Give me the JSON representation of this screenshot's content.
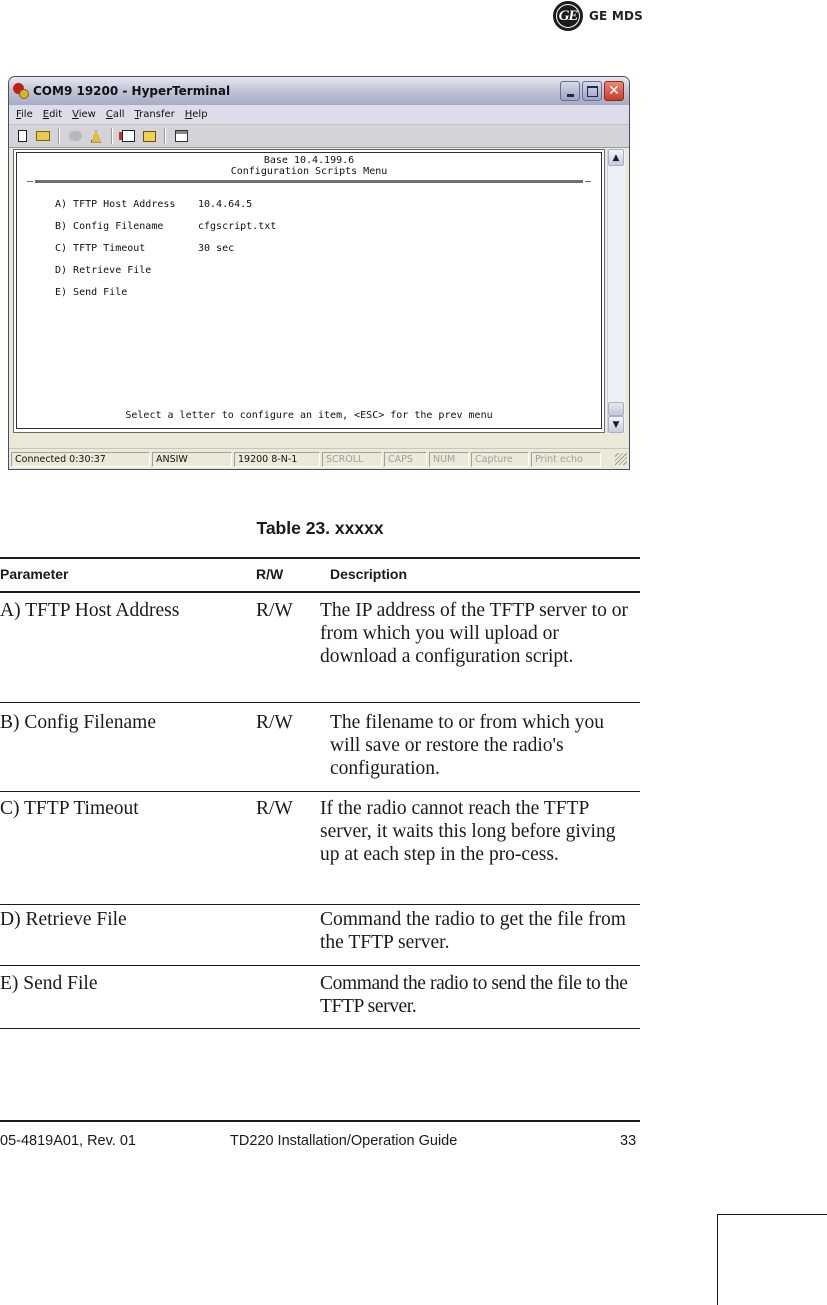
{
  "brand": {
    "logo_mark": "GE",
    "logo_text": "GE MDS"
  },
  "window": {
    "title": "COM9 19200 - HyperTerminal",
    "menu": [
      {
        "accel": "F",
        "rest": "ile"
      },
      {
        "accel": "E",
        "rest": "dit"
      },
      {
        "accel": "V",
        "rest": "iew"
      },
      {
        "accel": "C",
        "rest": "all"
      },
      {
        "accel": "T",
        "rest": "ransfer"
      },
      {
        "accel": "H",
        "rest": "elp"
      }
    ],
    "toolbar_icons": [
      "new-connection-icon",
      "open-icon",
      "connect-icon",
      "disconnect-icon",
      "send-icon",
      "receive-icon",
      "properties-icon"
    ],
    "terminal": {
      "header_line1": "Base 10.4.199.6",
      "header_line2": "Configuration Scripts Menu",
      "items": [
        {
          "label": "A) TFTP Host Address",
          "value": "10.4.64.5"
        },
        {
          "label": "B) Config Filename",
          "value": "cfgscript.txt"
        },
        {
          "label": "C) TFTP Timeout",
          "value": "30 sec"
        },
        {
          "label": "D) Retrieve File",
          "value": ""
        },
        {
          "label": "E) Send File",
          "value": ""
        }
      ],
      "prompt": "Select a letter to configure an item, <ESC> for the prev menu"
    },
    "statusbar": {
      "connected": "Connected 0:30:37",
      "emulation": "ANSIW",
      "settings": "19200 8-N-1",
      "scroll": "SCROLL",
      "caps": "CAPS",
      "num": "NUM",
      "capture": "Capture",
      "print_echo": "Print echo"
    }
  },
  "table": {
    "caption": "Table 23. xxxxx",
    "headers": {
      "parameter": "Parameter",
      "rw": "R/W",
      "description": "Description"
    },
    "rows": [
      {
        "parameter": "A) TFTP Host Address",
        "rw": "R/W",
        "description": "The IP address of the TFTP server to or from which you will upload or download a configuration script."
      },
      {
        "parameter": "B) Config Filename",
        "rw": "R/W",
        "description": "The filename to or from which you will save or restore the radio's configuration."
      },
      {
        "parameter": "C) TFTP Timeout",
        "rw": "R/W",
        "description": "If the radio cannot reach the TFTP server, it waits this long before giving up at each step in the pro-cess."
      },
      {
        "parameter": "D) Retrieve File",
        "rw": "",
        "description": "Command the radio to get the file from the TFTP server."
      },
      {
        "parameter": "E) Send File",
        "rw": "",
        "description": "Command the radio to send the file to the TFTP server."
      }
    ]
  },
  "footer": {
    "doc_number": "05-4819A01, Rev. 01",
    "doc_title": "TD220 Installation/Operation Guide",
    "page_number": "33"
  }
}
